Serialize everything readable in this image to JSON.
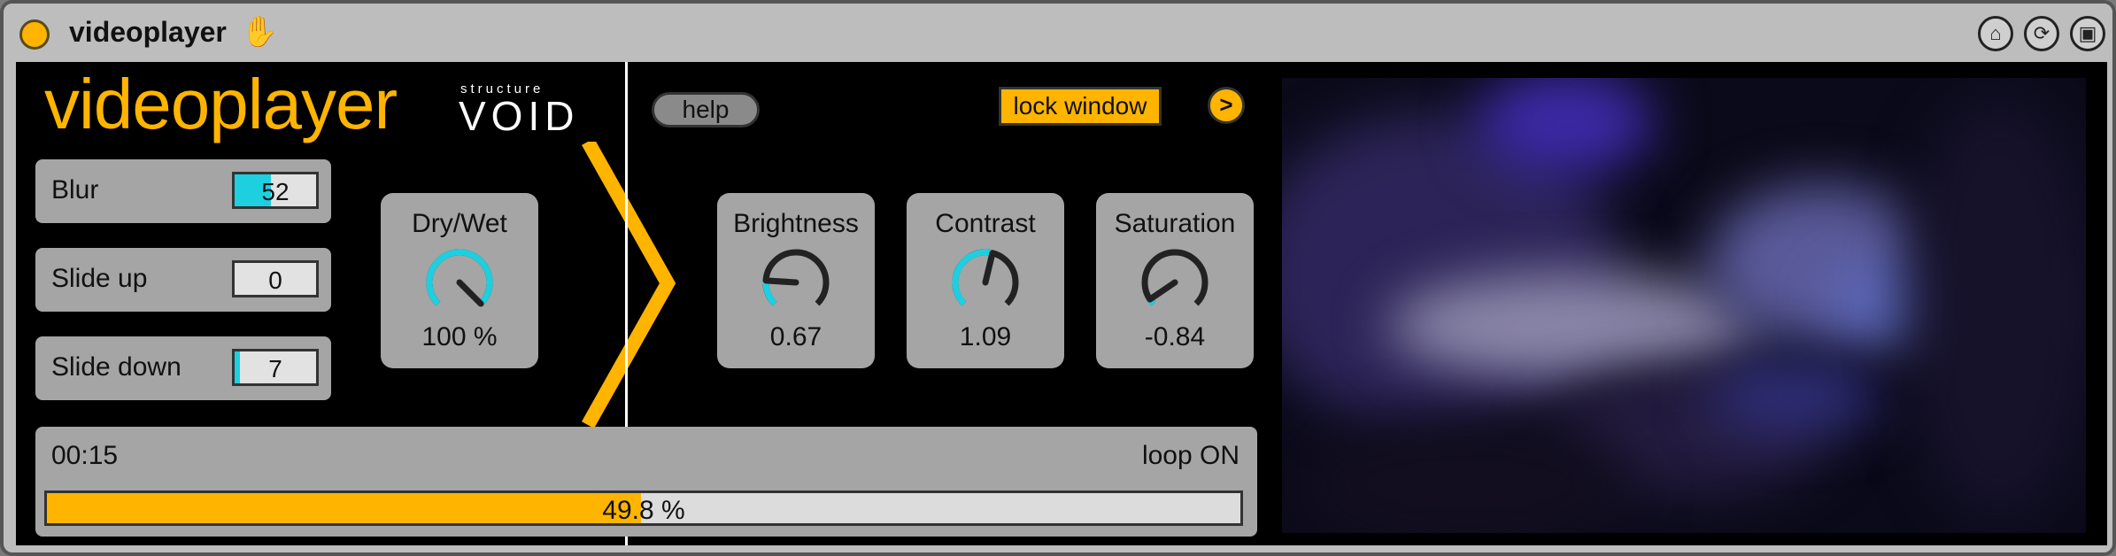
{
  "window": {
    "title": "videoplayer",
    "accent_color": "#ffb400",
    "knob_color": "#1ecfe0",
    "icons": [
      "fold-icon",
      "hand-icon",
      "pin-icon",
      "refresh-icon",
      "save-icon"
    ]
  },
  "header": {
    "brand": "videoplayer",
    "logo_small": "structure",
    "logo_big": "VOID",
    "help_label": "help",
    "lock_label": "lock window",
    "arrow_label": ">"
  },
  "params": [
    {
      "label": "Blur",
      "value": "52",
      "fill_fraction": 0.45
    },
    {
      "label": "Slide up",
      "value": "0",
      "fill_fraction": 0.0
    },
    {
      "label": "Slide down",
      "value": "7",
      "fill_fraction": 0.06
    }
  ],
  "knobs": [
    {
      "label": "Dry/Wet",
      "value": "100 %",
      "level": 1.0
    },
    {
      "label": "Brightness",
      "value": "0.67",
      "level": 0.18
    },
    {
      "label": "Contrast",
      "value": "1.09",
      "level": 0.55
    },
    {
      "label": "Saturation",
      "value": "-0.84",
      "level": 0.04
    }
  ],
  "transport": {
    "time": "00:15",
    "loop": "loop ON",
    "progress_text": "49.8 %",
    "progress": 0.498
  }
}
